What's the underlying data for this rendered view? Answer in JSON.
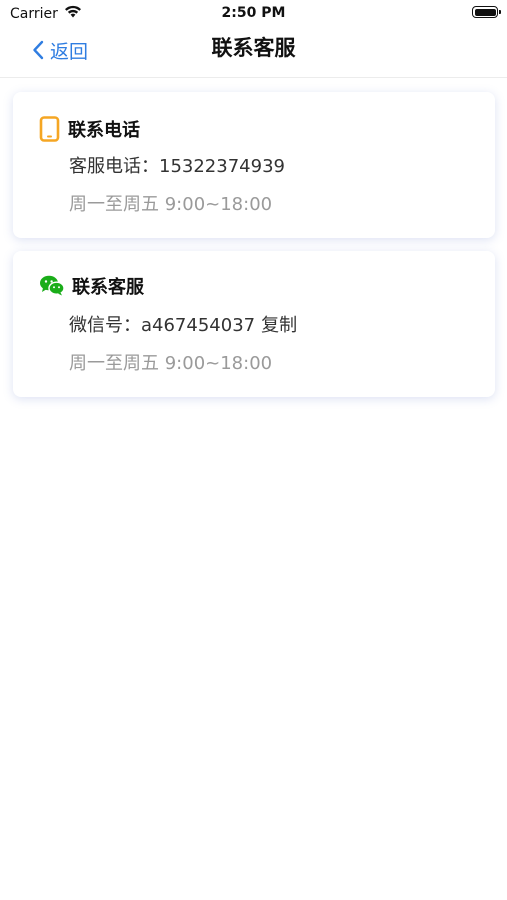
{
  "status_bar": {
    "carrier": "Carrier",
    "time": "2:50 PM"
  },
  "nav": {
    "back_label": "返回",
    "title": "联系客服"
  },
  "phone_card": {
    "icon": "phone-icon",
    "icon_color": "#f5a623",
    "title": "联系电话",
    "label": "客服电话：15322374939",
    "hours": "周一至周五 9:00~18:00"
  },
  "wechat_card": {
    "icon": "wechat-icon",
    "icon_color": "#1aad19",
    "title": "联系客服",
    "label": "微信号：a467454037",
    "copy_label": "复制",
    "hours": "周一至周五 9:00~18:00"
  },
  "colors": {
    "accent": "#2f7de1",
    "hours_text": "#9a9a9a"
  }
}
